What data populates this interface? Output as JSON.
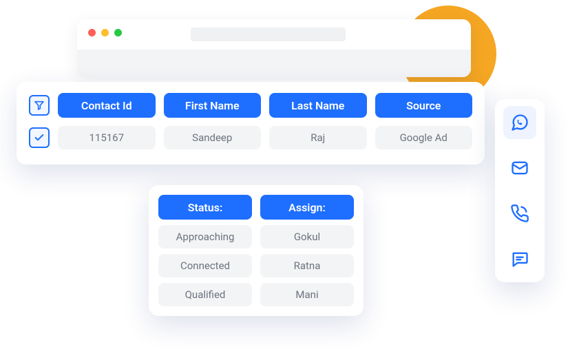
{
  "colors": {
    "primary": "#1E6EFF",
    "accent": "#F5A623",
    "muted": "#F3F4F5",
    "text_muted": "#6C7380"
  },
  "toolbar": {
    "traffic": [
      "red",
      "yellow",
      "green"
    ]
  },
  "table": {
    "columns": [
      "Contact Id",
      "First Name",
      "Last Name",
      "Source"
    ],
    "row": [
      "115167",
      "Sandeep",
      "Raj",
      "Google Ad"
    ]
  },
  "popup": {
    "status_label": "Status:",
    "assign_label": "Assign:",
    "status_items": [
      "Approaching",
      "Connected",
      "Qualified"
    ],
    "assign_items": [
      "Gokul",
      "Ratna",
      "Mani"
    ]
  },
  "rail": {
    "items": [
      "whatsapp",
      "mail",
      "phone",
      "chat"
    ]
  }
}
